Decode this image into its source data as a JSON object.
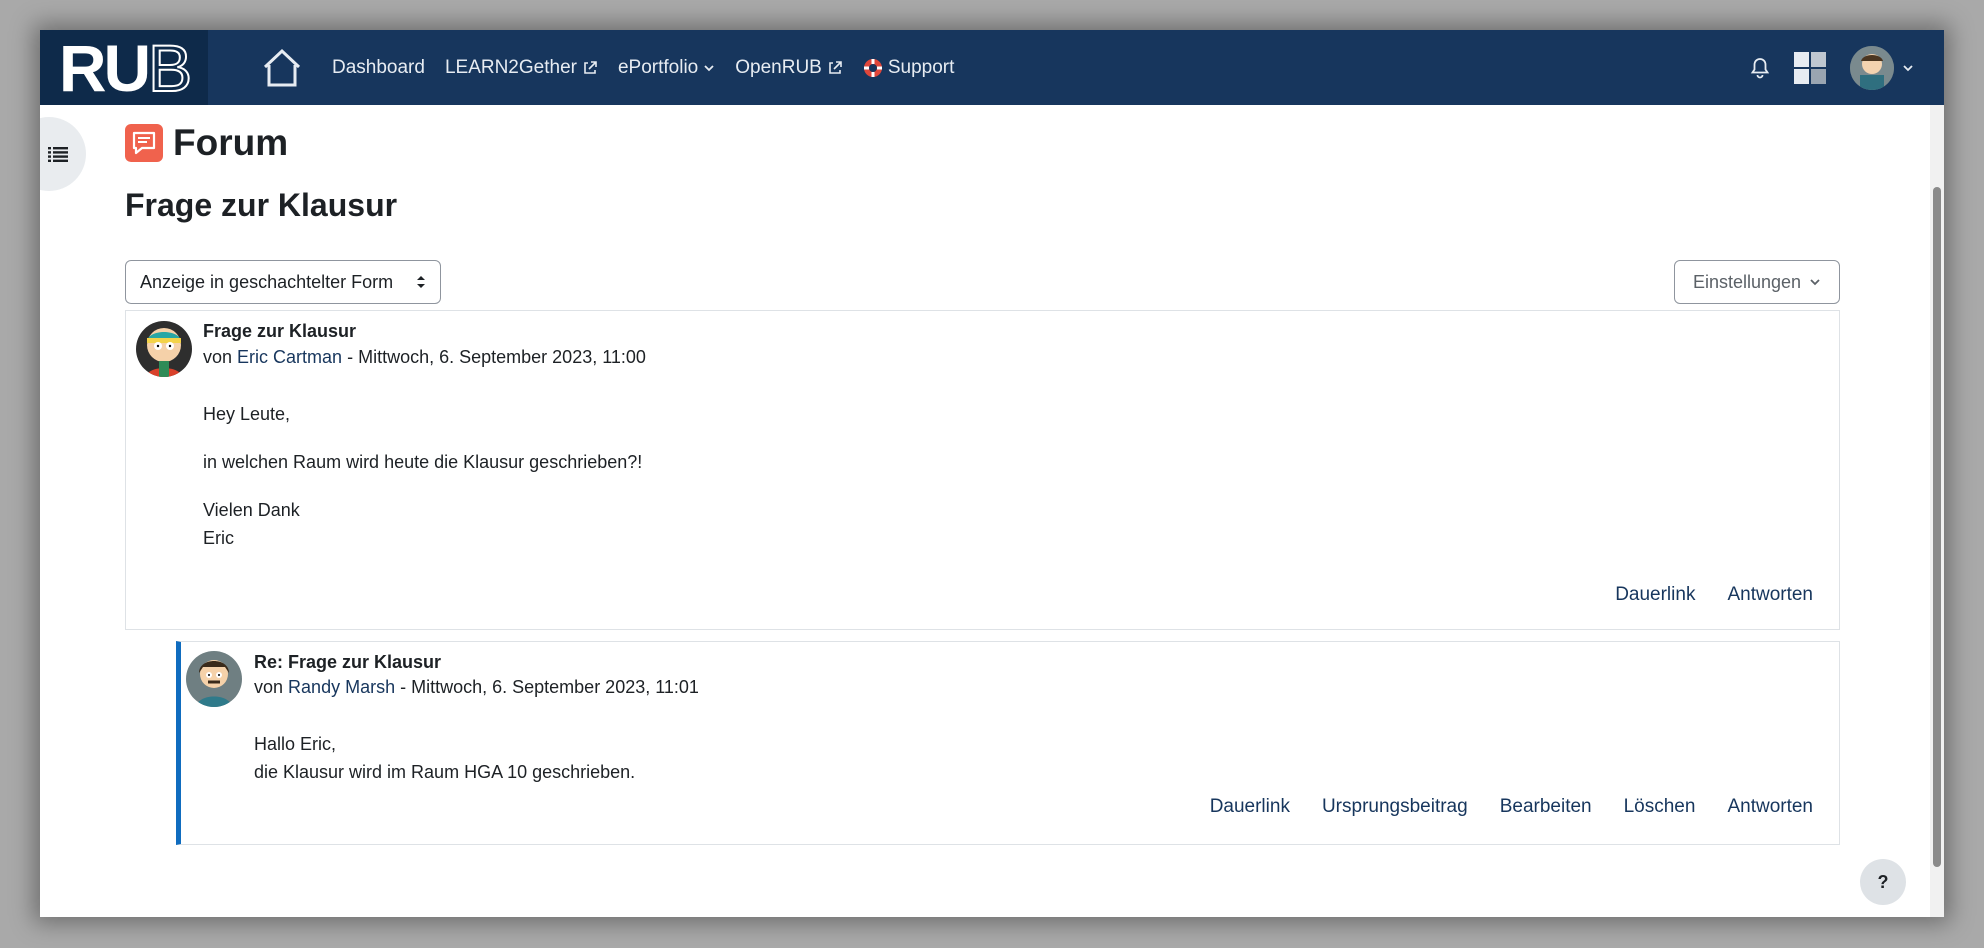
{
  "navbar": {
    "logo": {
      "text_bold": "RU",
      "text_outline": "B"
    },
    "links": [
      {
        "label": "Dashboard",
        "external": false,
        "dropdown": false,
        "icon": ""
      },
      {
        "label": "LEARN2Gether",
        "external": true,
        "dropdown": false,
        "icon": ""
      },
      {
        "label": "ePortfolio",
        "external": false,
        "dropdown": true,
        "icon": ""
      },
      {
        "label": "OpenRUB",
        "external": true,
        "dropdown": false,
        "icon": ""
      },
      {
        "label": "Support",
        "external": false,
        "dropdown": false,
        "icon": "lifebuoy-icon"
      }
    ],
    "right_icons": [
      "bell-icon",
      "grid-icon",
      "user-avatar",
      "chevron-down-icon"
    ]
  },
  "page": {
    "module_title": "Forum",
    "discussion_title": "Frage zur Klausur",
    "display_mode": "Anzeige in geschachtelter Form",
    "settings_label": "Einstellungen"
  },
  "posts": [
    {
      "subject": "Frage zur Klausur",
      "by_prefix": "von",
      "author": "Eric Cartman",
      "date": "- Mittwoch, 6. September 2023, 11:00",
      "body": [
        "Hey Leute,",
        "in welchen Raum wird heute die Klausur geschrieben?!",
        "Vielen Dank",
        "Eric"
      ],
      "actions": [
        "Dauerlink",
        "Antworten"
      ]
    },
    {
      "subject": "Re: Frage zur Klausur",
      "by_prefix": "von",
      "author": "Randy Marsh",
      "date": "- Mittwoch, 6. September 2023, 11:01",
      "body": [
        "Hallo Eric,",
        "die Klausur wird im Raum HGA 10 geschrieben."
      ],
      "actions": [
        "Dauerlink",
        "Ursprungsbeitrag",
        "Bearbeiten",
        "Löschen",
        "Antworten"
      ]
    }
  ],
  "help": {
    "label": "?"
  },
  "colors": {
    "navbar": "#17365d",
    "link": "#17365d",
    "forum_icon": "#f0624d",
    "reply_border": "#0f6cbf"
  }
}
